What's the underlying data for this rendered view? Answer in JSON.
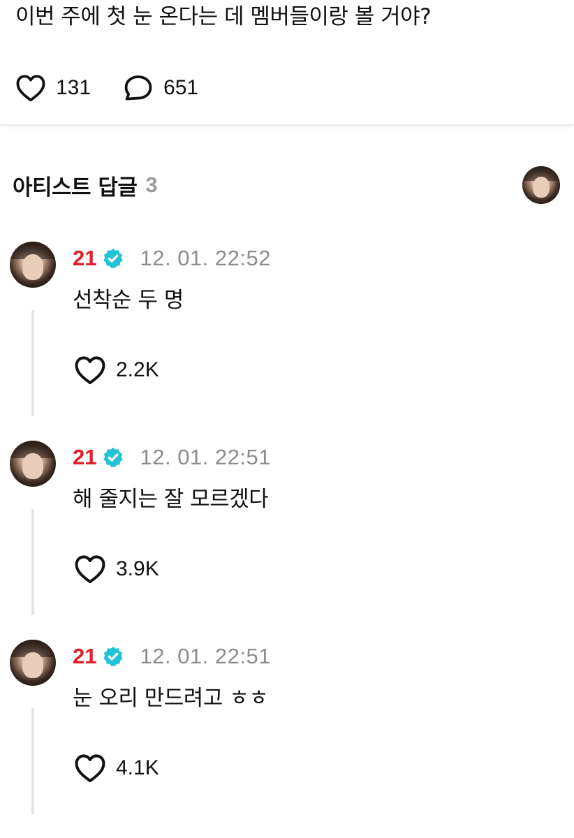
{
  "post": {
    "text": "이번 주에 첫 눈 온다는 데 멤버들이랑 볼 거야?",
    "like_count": "131",
    "comment_count": "651"
  },
  "artist_replies": {
    "title": "아티스트 답글",
    "count": "3",
    "replies": [
      {
        "username": "21",
        "timestamp": "12. 01. 22:52",
        "text": "선착순 두 명",
        "like_count": "2.2K"
      },
      {
        "username": "21",
        "timestamp": "12. 01. 22:51",
        "text": "해 줄지는 잘 모르겠다",
        "like_count": "3.9K"
      },
      {
        "username": "21",
        "timestamp": "12. 01. 22:51",
        "text": "눈 오리 만드려고 ㅎㅎ",
        "like_count": "4.1K"
      }
    ]
  },
  "icons": {
    "like": "heart-outline-icon",
    "comment": "speech-bubble-icon",
    "verified": "verified-badge-icon"
  },
  "colors": {
    "username": "#e01f26",
    "verified": "#22c3d6",
    "timestamp": "#8c8c8c",
    "count_muted": "#9a9a9a"
  }
}
